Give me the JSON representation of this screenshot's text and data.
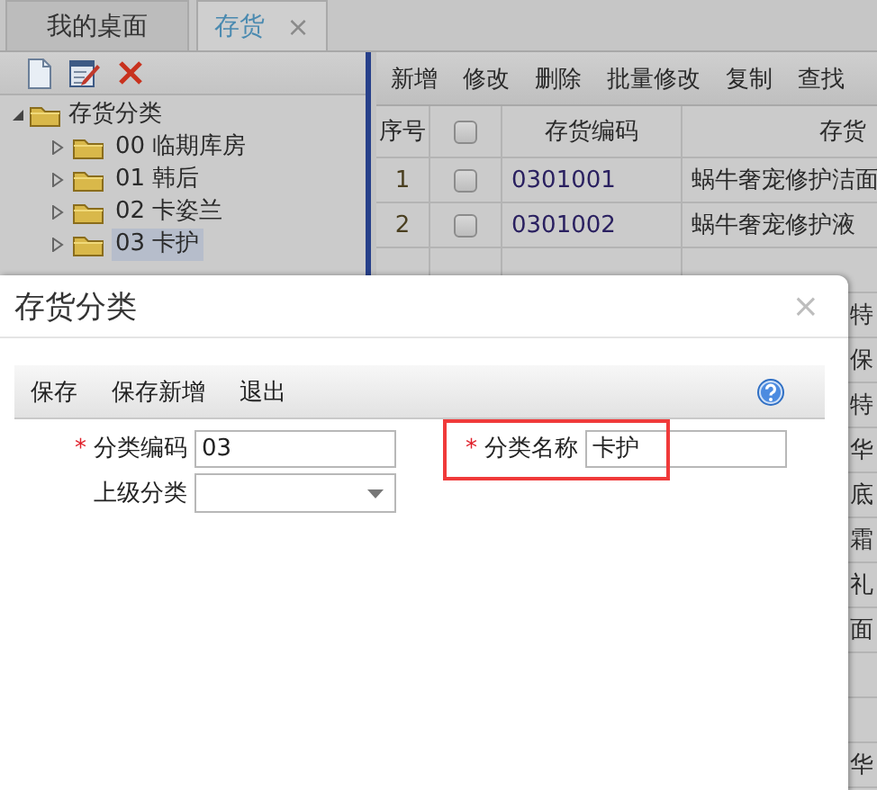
{
  "tabs": [
    {
      "label": "我的桌面",
      "selected": false
    },
    {
      "label": "存货",
      "selected": true,
      "close": "×"
    }
  ],
  "tree": {
    "label": "存货分类",
    "expanded": true,
    "children": [
      {
        "label": "00 临期库房",
        "expanded": false,
        "selected": false
      },
      {
        "label": "01 韩后",
        "expanded": false,
        "selected": false
      },
      {
        "label": "02 卡姿兰",
        "expanded": false,
        "selected": false
      },
      {
        "label": "03 卡护",
        "expanded": false,
        "selected": true
      }
    ]
  },
  "toolbar": [
    "新增",
    "修改",
    "删除",
    "批量修改",
    "复制",
    "查找"
  ],
  "table": {
    "columns": [
      "序号",
      {
        "kind": "checkbox",
        "checked": false
      },
      "存货编码",
      "存货"
    ],
    "rows": [
      {
        "index": "1",
        "checked": false,
        "code": "0301001",
        "name": "蜗牛奢宠修护洁面"
      },
      {
        "index": "2",
        "checked": false,
        "code": "0301002",
        "name": "蜗牛奢宠修护液"
      },
      {},
      {
        "name_tail": "特"
      },
      {
        "name_tail": "保"
      },
      {
        "name_tail": "特"
      },
      {
        "name_tail": "华"
      },
      {
        "name_tail": "底"
      },
      {
        "name_tail": "霜"
      },
      {
        "name_tail": "礼"
      },
      {
        "name_tail": "面"
      },
      {},
      {},
      {
        "name_tail": "华"
      }
    ]
  },
  "dialog": {
    "title": "存货分类",
    "close": "×",
    "buttons": [
      "保存",
      "保存新增",
      "退出"
    ],
    "fields": [
      {
        "kind": "text",
        "label": "分类编码",
        "required_mark": "*",
        "value": "03",
        "highlighted": false
      },
      {
        "kind": "text",
        "label": "分类名称",
        "required_mark": "*",
        "value": "卡护",
        "highlighted": true
      },
      {
        "kind": "select",
        "label": "上级分类",
        "highlighted": false
      }
    ]
  }
}
